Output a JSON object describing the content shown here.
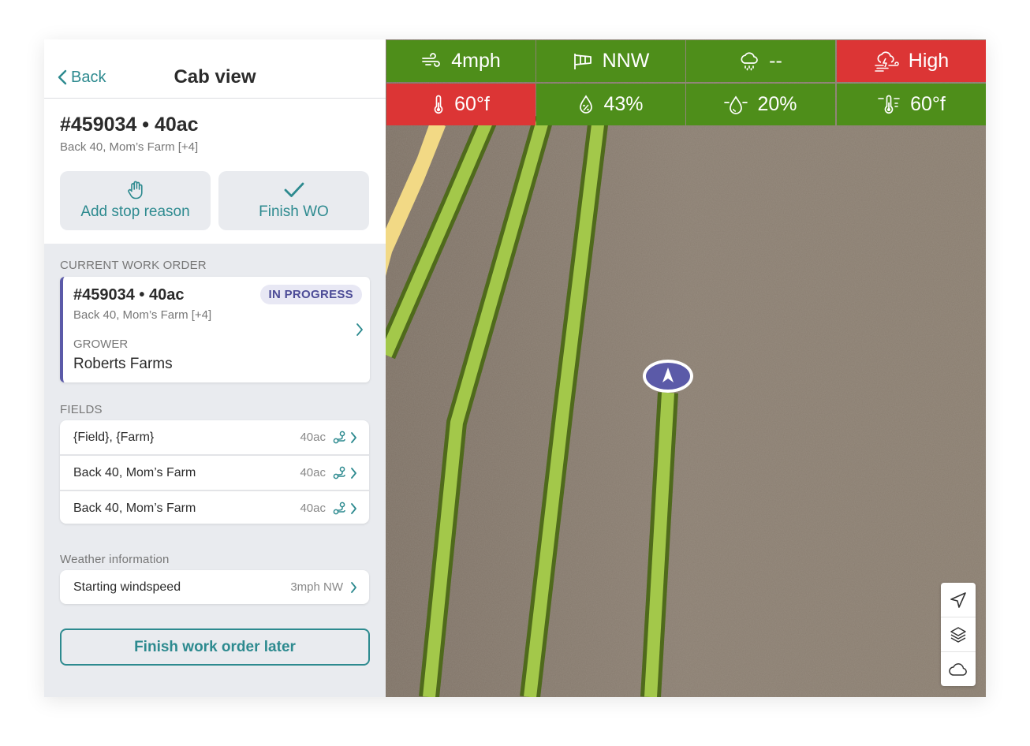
{
  "nav": {
    "back_label": "Back",
    "title": "Cab view"
  },
  "work_order": {
    "title": "#459034 • 40ac",
    "subtitle": "Back 40, Mom’s Farm [+4]"
  },
  "actions": {
    "stop_label": "Add stop reason",
    "finish_label": "Finish WO"
  },
  "current_work_order": {
    "section_label": "CURRENT WORK ORDER",
    "title": "#459034 • 40ac",
    "subtitle": "Back 40, Mom’s Farm [+4]",
    "status": "IN PROGRESS",
    "grower_label": "GROWER",
    "grower": "Roberts Farms"
  },
  "fields": {
    "section_label": "FIELDS",
    "rows": [
      {
        "name": "{Field}, {Farm}",
        "acres": "40ac"
      },
      {
        "name": "Back 40, Mom’s Farm",
        "acres": "40ac"
      },
      {
        "name": "Back 40, Mom’s Farm",
        "acres": "40ac"
      }
    ]
  },
  "weather": {
    "section_label": "Weather information",
    "row_label": "Starting windspeed",
    "row_value": "3mph NW"
  },
  "later_button": "Finish work order later",
  "conditions": [
    {
      "icon": "wind-icon",
      "value": "4mph",
      "status": "good"
    },
    {
      "icon": "windsock-icon",
      "value": "NNW",
      "status": "good"
    },
    {
      "icon": "rain-cloud-icon",
      "value": "--",
      "status": "good"
    },
    {
      "icon": "storm-icon",
      "value": "High",
      "status": "bad"
    },
    {
      "icon": "thermometer-icon",
      "value": "60°f",
      "status": "bad"
    },
    {
      "icon": "humidity-icon",
      "value": "43%",
      "status": "good"
    },
    {
      "icon": "dew-point-icon",
      "value": "20%",
      "status": "good"
    },
    {
      "icon": "temperature-inversion-icon",
      "value": "60°f",
      "status": "good"
    }
  ],
  "colors": {
    "accent": "#2d8a8f",
    "status_good": "#4e8e1a",
    "status_bad": "#dc3535",
    "in_progress": "#5b5aa8",
    "pass_fill": "#a3c84a",
    "pass_outline": "#4f6a1c"
  },
  "map_controls": [
    "navigate-icon",
    "layers-icon",
    "cloud-icon"
  ]
}
